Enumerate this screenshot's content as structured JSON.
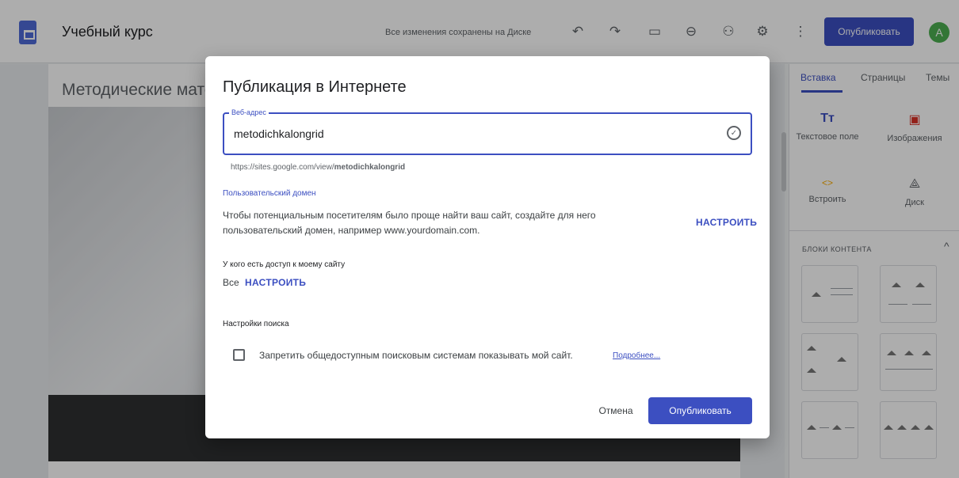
{
  "header": {
    "title": "Учебный курс",
    "save_status": "Все изменения сохранены на Диске",
    "publish_label": "Опубликовать",
    "avatar_letter": "A",
    "icons": [
      "undo-icon",
      "redo-icon",
      "preview-icon",
      "link-icon",
      "share-icon",
      "settings-icon",
      "more-icon"
    ]
  },
  "editor": {
    "page_title": "Методические мате"
  },
  "side_panel": {
    "tabs": [
      "Вставка",
      "Страницы",
      "Темы"
    ],
    "insert_items": [
      {
        "label": "Текстовое поле",
        "icon": "Тт"
      },
      {
        "label": "Изображения",
        "icon": "▣"
      },
      {
        "label": "Встроить",
        "icon": "<>"
      },
      {
        "label": "Диск",
        "icon": "⟁"
      }
    ],
    "blocks_title": "БЛОКИ КОНТЕНТА"
  },
  "dialog": {
    "title": "Публикация в Интернете",
    "url_legend": "Веб-адрес",
    "url_value": "metodichkalongrid",
    "url_prefix": "https://sites.google.com/view/",
    "url_slug": "metodichkalongrid",
    "custom_domain_title": "Пользовательский домен",
    "custom_domain_text": "Чтобы потенциальным посетителям было проще найти ваш сайт, создайте для него пользовательский домен, например www.yourdomain.com.",
    "custom_domain_action": "НАСТРОИТЬ",
    "access_title": "У кого есть доступ к моему сайту",
    "access_value": "Все",
    "access_action": "НАСТРОИТЬ",
    "search_title": "Настройки поиска",
    "search_checkbox_label": "Запретить общедоступным поисковым системам показывать мой сайт.",
    "search_more_link": "Подробнее...",
    "cancel_label": "Отмена",
    "publish_label": "Опубликовать",
    "accent_color": "#3c4fc1"
  }
}
